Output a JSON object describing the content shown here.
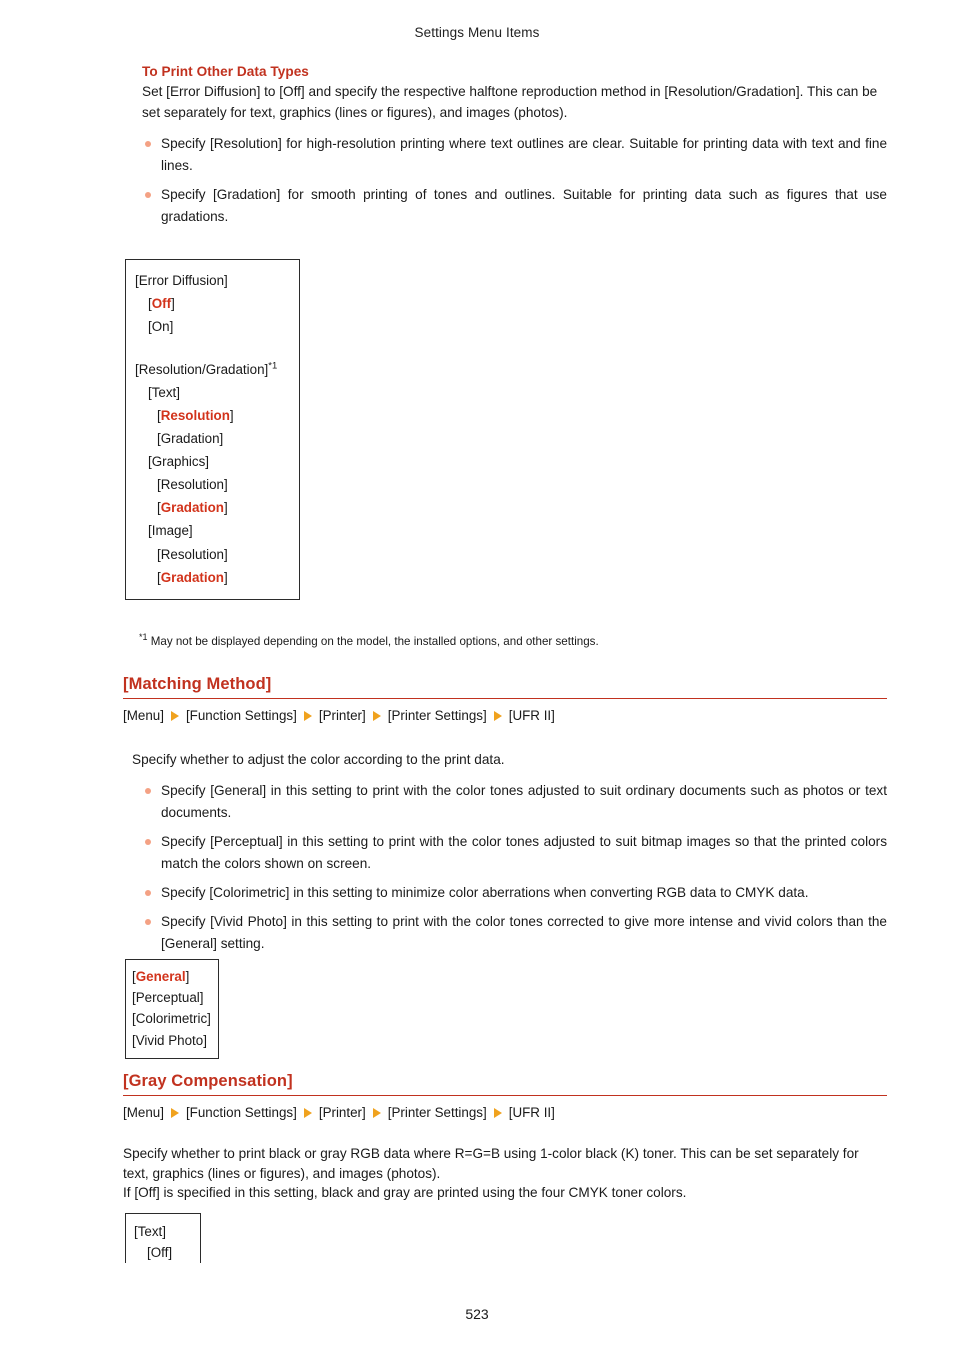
{
  "header": {
    "running_title": "Settings Menu Items"
  },
  "page_number": "523",
  "sections": {
    "print_other_data_types": {
      "heading": "To Print Other Data Types",
      "intro": "Set [Error Diffusion] to [Off] and specify the respective halftone reproduction method in [Resolution/Gradation]. This can be set separately for text, graphics (lines or figures), and images (photos).",
      "bullets": [
        "Specify [Resolution] for high-resolution printing where text outlines are clear. Suitable for printing data with text and fine lines.",
        "Specify [Gradation] for smooth printing of tones and outlines. Suitable for printing data such as figures that use gradations."
      ],
      "option_box": {
        "lines": [
          {
            "level": 1,
            "text": "[Error Diffusion]",
            "highlight": false
          },
          {
            "level": 2,
            "pre": "[",
            "text": "Off",
            "post": "]",
            "highlight": true
          },
          {
            "level": 2,
            "text": "[On]",
            "highlight": false
          },
          {
            "level": 1,
            "spacer": true,
            "text": ""
          },
          {
            "level": 1,
            "text": "[Resolution/Gradation]",
            "footnote": "*1",
            "highlight": false
          },
          {
            "level": 2,
            "text": "[Text]",
            "highlight": false
          },
          {
            "level": 3,
            "pre": "[",
            "text": "Resolution",
            "post": "]",
            "highlight": true
          },
          {
            "level": 3,
            "text": "[Gradation]",
            "highlight": false
          },
          {
            "level": 2,
            "text": "[Graphics]",
            "highlight": false
          },
          {
            "level": 3,
            "text": "[Resolution]",
            "highlight": false
          },
          {
            "level": 3,
            "pre": "[",
            "text": "Gradation",
            "post": "]",
            "highlight": true
          },
          {
            "level": 2,
            "text": "[Image]",
            "highlight": false
          },
          {
            "level": 3,
            "text": "[Resolution]",
            "highlight": false
          },
          {
            "level": 3,
            "pre": "[",
            "text": "Gradation",
            "post": "]",
            "highlight": true
          }
        ]
      },
      "footnote": {
        "marker": "*1",
        "text": " May not be displayed depending on the model, the installed options, and other settings."
      }
    },
    "matching_method": {
      "heading": "[Matching Method]",
      "breadcrumb": [
        "[Menu]",
        "[Function Settings]",
        "[Printer]",
        "[Printer Settings]",
        "[UFR II]"
      ],
      "intro": "Specify whether to adjust the color according to the print data.",
      "bullets": [
        "Specify [General] in this setting to print with the color tones adjusted to suit ordinary documents such as photos or text documents.",
        "Specify [Perceptual] in this setting to print with the color tones adjusted to suit bitmap images so that the printed colors match the colors shown on screen.",
        "Specify [Colorimetric] in this setting to minimize color aberrations when converting RGB data to CMYK data.",
        "Specify [Vivid Photo] in this setting to print with the color tones corrected to give more intense and vivid colors than the [General] setting."
      ],
      "option_box": {
        "lines": [
          {
            "level": 1,
            "pre": "[",
            "text": "General",
            "post": "]",
            "highlight": true
          },
          {
            "level": 1,
            "text": "[Perceptual]",
            "highlight": false
          },
          {
            "level": 1,
            "text": "[Colorimetric]",
            "highlight": false
          },
          {
            "level": 1,
            "text": "[Vivid Photo]",
            "highlight": false
          }
        ]
      }
    },
    "gray_compensation": {
      "heading": "[Gray Compensation]",
      "breadcrumb": [
        "[Menu]",
        "[Function Settings]",
        "[Printer]",
        "[Printer Settings]",
        "[UFR II]"
      ],
      "paragraph_1": "Specify whether to print black or gray RGB data where R=G=B using 1-color black (K) toner. This can be set separately for text, graphics (lines or figures), and images (photos).",
      "paragraph_2": "If [Off] is specified in this setting, black and gray are printed using the four CMYK toner colors.",
      "option_box": {
        "lines": [
          {
            "level": 1,
            "text": "[Text]",
            "highlight": false
          },
          {
            "level": 2,
            "text": "[Off]",
            "highlight": false
          }
        ]
      }
    }
  },
  "colors": {
    "heading_red": "#C1321F",
    "highlight_red": "#D2331B",
    "bullet_dot": "#F4A184",
    "breadcrumb_arrow": "#F0A21E",
    "box_border": "#2b2b2b",
    "body_text": "#1a1a1a"
  }
}
